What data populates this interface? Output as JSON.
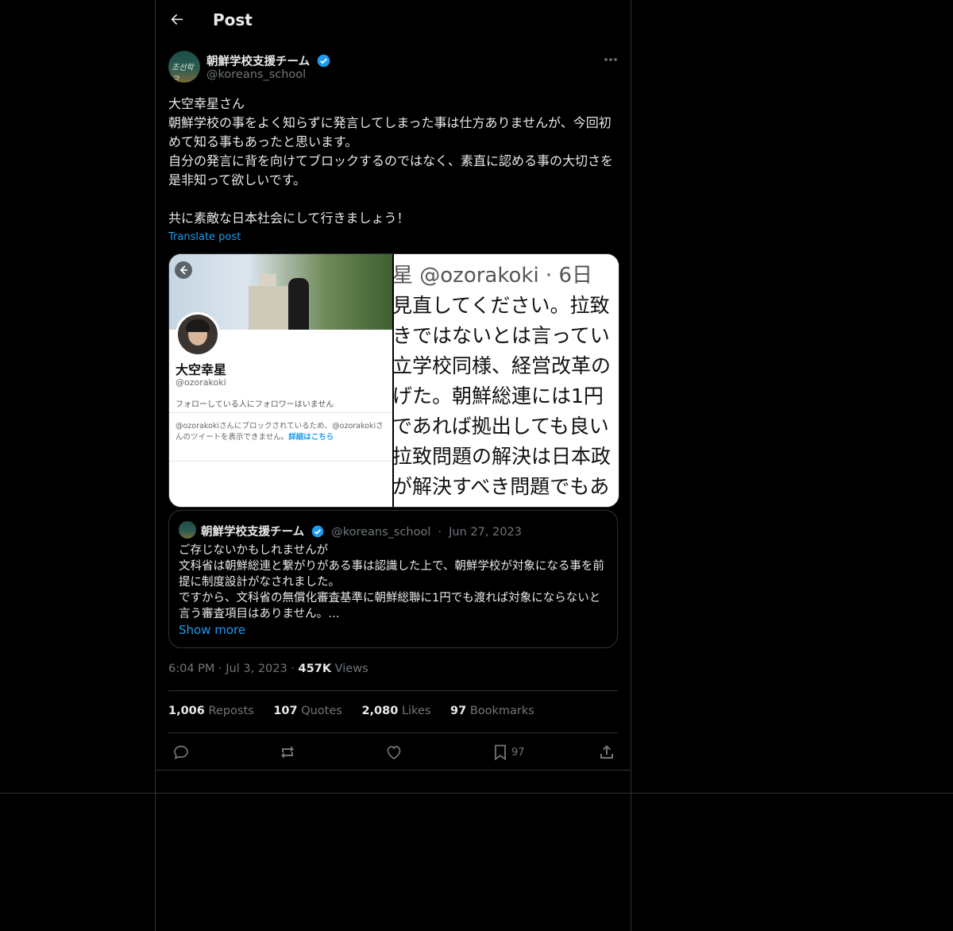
{
  "header": {
    "title": "Post"
  },
  "author": {
    "name": "朝鮮学校支援チーム",
    "handle": "@koreans_school",
    "avatar_text": "조선학교",
    "verified": true
  },
  "post": {
    "text": "大空幸星さん\n朝鮮学校の事をよく知らずに発言してしまった事は仕方ありませんが、今回初めて知る事もあったと思います。\n自分の発言に背を向けてブロックするのではなく、素直に認める事の大切さを是非知って欲しいです。\n\n共に素敵な日本社会にして行きましょう！",
    "translate_label": "Translate post"
  },
  "media": {
    "left": {
      "profile_name": "大空幸星",
      "profile_handle": "@ozorakoki",
      "follow_text": "フォローしている人にフォロワーはいません",
      "block_text": "@ozorakokiさんにブロックされているため、@ozorakokiさんのツイートを表示できません。",
      "block_link": "詳細はこちら"
    },
    "right": {
      "lines": [
        "星 @ozorakoki · 6日",
        "見直してください。拉致",
        "きではないとは言ってい",
        "立学校同様、経営改革の",
        "げた。朝鮮総連には1円",
        "であれば拠出しても良い",
        "拉致問題の解決は日本政",
        "が解決すべき問題でもあ"
      ]
    }
  },
  "quote": {
    "name": "朝鮮学校支援チーム",
    "handle": "@koreans_school",
    "date": "Jun 27, 2023",
    "dot": "·",
    "text": "ご存じないかもしれませんが\n文科省は朝鮮総連と繋がりがある事は認識した上で、朝鮮学校が対象になる事を前提に制度設計がなされました。\nですから、文科省の無償化審査基準に朝鮮総聯に1円でも渡れば対象にならないと言う審査項目はありません。…",
    "show_more": "Show more"
  },
  "meta": {
    "time": "6:04 PM",
    "date": "Jul 3, 2023",
    "views_count": "457K",
    "views_label": "Views",
    "dot": "·"
  },
  "stats": {
    "reposts_count": "1,006",
    "reposts_label": "Reposts",
    "quotes_count": "107",
    "quotes_label": "Quotes",
    "likes_count": "2,080",
    "likes_label": "Likes",
    "bookmarks_count": "97",
    "bookmarks_label": "Bookmarks"
  },
  "actions": {
    "bookmark_count": "97"
  },
  "colors": {
    "accent": "#1d9bf0",
    "text": "#e7e9ea",
    "muted": "#71767b",
    "border": "#2f3336",
    "background": "#000000"
  }
}
